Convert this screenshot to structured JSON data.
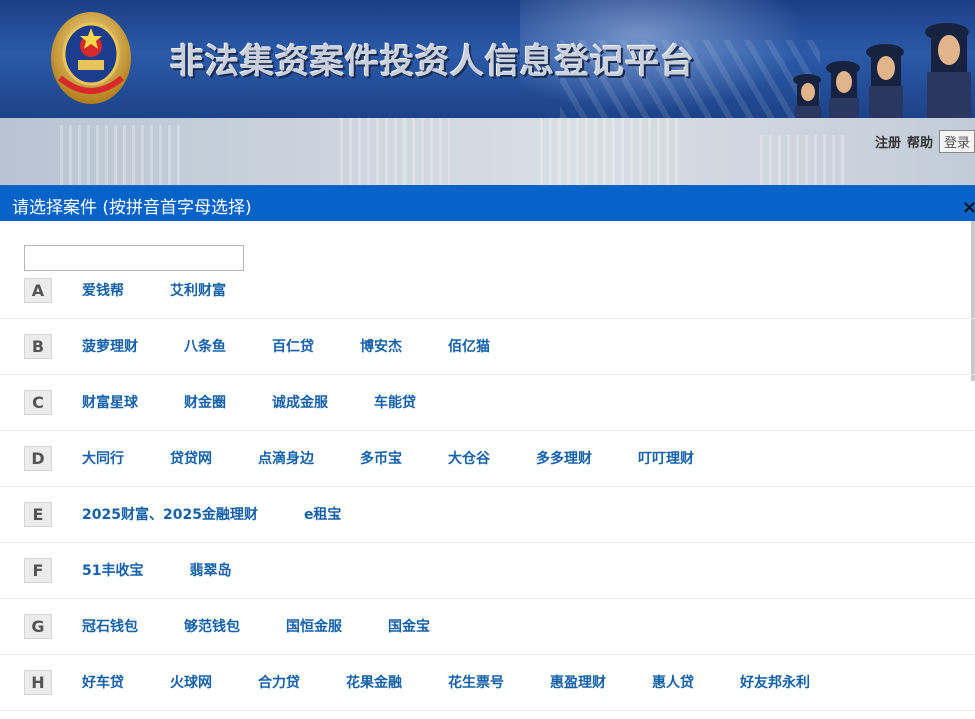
{
  "header": {
    "site_title": "非法集资案件投资人信息登记平台",
    "links": {
      "register": "注册",
      "help": "帮助",
      "login": "登录"
    }
  },
  "dialog": {
    "title": "请选择案件 (按拼音首字母选择)",
    "close": "×",
    "search": {
      "value": "",
      "placeholder": ""
    },
    "groups": [
      {
        "letter": "A",
        "cases": [
          "爱钱帮",
          "艾利财富"
        ]
      },
      {
        "letter": "B",
        "cases": [
          "菠萝理财",
          "八条鱼",
          "百仁贷",
          "博安杰",
          "佰亿猫"
        ]
      },
      {
        "letter": "C",
        "cases": [
          "财富星球",
          "财金圈",
          "诚成金服",
          "车能贷"
        ]
      },
      {
        "letter": "D",
        "cases": [
          "大同行",
          "贷贷网",
          "点滴身边",
          "多币宝",
          "大仓谷",
          "多多理财",
          "叮叮理财"
        ]
      },
      {
        "letter": "E",
        "cases": [
          "2025财富、2025金融理财",
          "e租宝"
        ]
      },
      {
        "letter": "F",
        "cases": [
          "51丰收宝",
          "翡翠岛"
        ]
      },
      {
        "letter": "G",
        "cases": [
          "冠石钱包",
          "够范钱包",
          "国恒金服",
          "国金宝"
        ]
      },
      {
        "letter": "H",
        "cases": [
          "好车贷",
          "火球网",
          "合力贷",
          "花果金融",
          "花生票号",
          "惠盈理财",
          "惠人贷",
          "好友邦永利"
        ]
      }
    ]
  },
  "colors": {
    "dialog_header": "#0863c9",
    "link": "#1561a8",
    "banner": "#2b5aa8"
  },
  "icons": {
    "close": "close-icon",
    "emblem": "police-emblem-icon"
  }
}
